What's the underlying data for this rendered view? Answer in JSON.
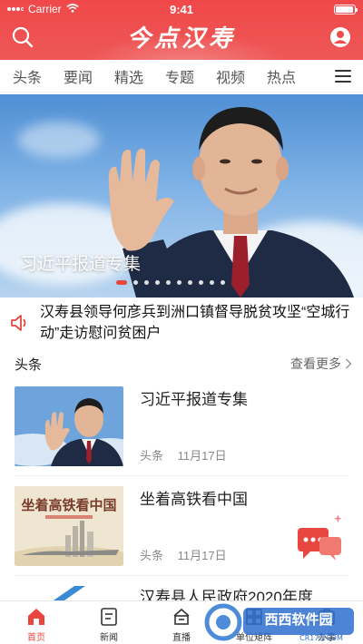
{
  "status_bar": {
    "carrier": "Carrier",
    "time": "9:41"
  },
  "header": {
    "title": "今点汉寿"
  },
  "tabs": [
    {
      "label": "头条"
    },
    {
      "label": "要闻"
    },
    {
      "label": "精选"
    },
    {
      "label": "专题"
    },
    {
      "label": "视频"
    },
    {
      "label": "热点"
    },
    {
      "label": "扌"
    }
  ],
  "banner": {
    "caption": "习近平报道专集",
    "slide_count": 10,
    "active_slide": 1
  },
  "notice": {
    "text": "汉寿县领导何彦兵到洲口镇督导脱贫攻坚“空城行动”走访慰问贫困户"
  },
  "section": {
    "title": "头条",
    "more_label": "查看更多"
  },
  "news": [
    {
      "title": "习近平报道专集",
      "category": "头条",
      "date": "11月17日"
    },
    {
      "title": "坐着高铁看中国",
      "category": "头条",
      "date": "11月17日"
    },
    {
      "title": "汉寿县人民政府2020年度"
    }
  ],
  "thumb_text": {
    "item2": "坐着高铁看中国"
  },
  "bottom_nav": [
    {
      "label": "首页",
      "icon": "home-icon",
      "active": true
    },
    {
      "label": "新闻",
      "icon": "news-icon",
      "active": false
    },
    {
      "label": "直播",
      "icon": "live-icon",
      "active": false
    },
    {
      "label": "单位矩阵",
      "icon": "matrix-icon",
      "active": false
    },
    {
      "label": "办事",
      "icon": "service-icon",
      "active": false
    }
  ],
  "watermark": {
    "brand": "西西软件园",
    "domain": "CR173.COM"
  },
  "colors": {
    "accent": "#e8473f",
    "header_red": "#ef4d4d"
  }
}
